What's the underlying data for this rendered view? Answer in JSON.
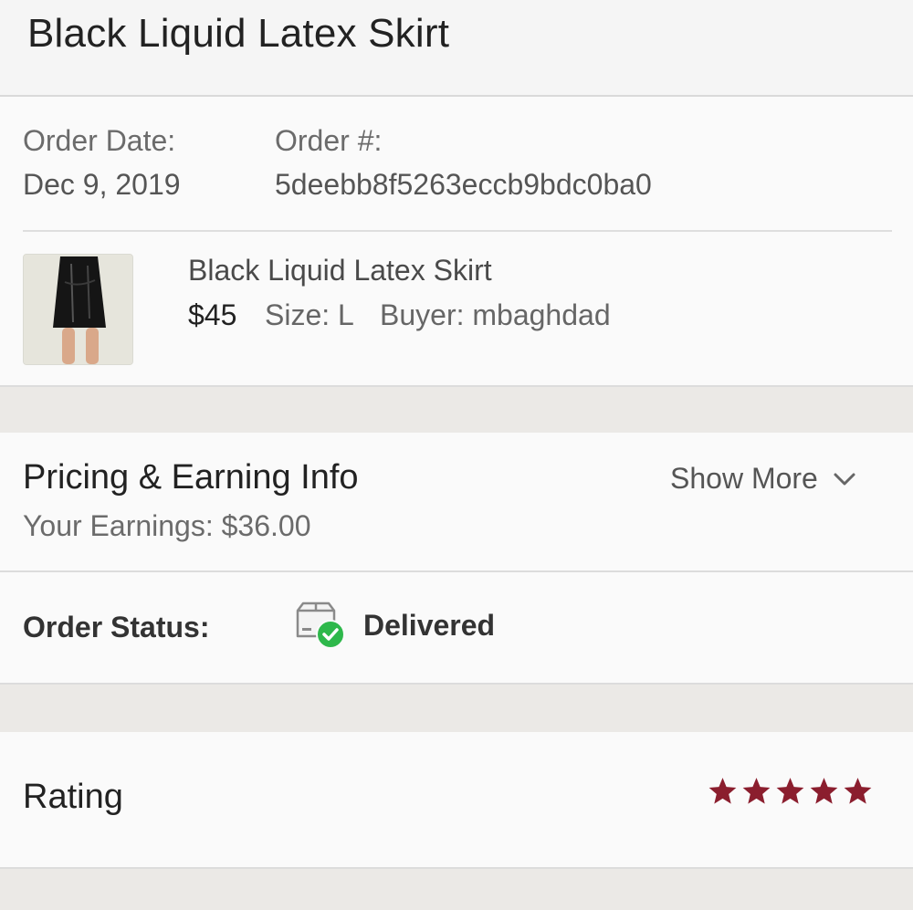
{
  "header": {
    "title": "Black Liquid Latex Skirt"
  },
  "order": {
    "date_label": "Order Date:",
    "date_value": "Dec 9, 2019",
    "number_label": "Order #:",
    "number_value": "5deebb8f5263eccb9bdc0ba0"
  },
  "item": {
    "name": "Black Liquid Latex Skirt",
    "price": "$45",
    "size": "Size: L",
    "buyer": "Buyer: mbaghdad"
  },
  "pricing": {
    "title": "Pricing & Earning Info",
    "earnings": "Your Earnings: $36.00",
    "show_more": "Show More"
  },
  "status": {
    "label": "Order Status:",
    "value": "Delivered"
  },
  "rating": {
    "label": "Rating",
    "stars": 5,
    "max": 5,
    "star_color": "#8b1e2e"
  },
  "colors": {
    "check_green": "#2eb84b",
    "section_gap": "#ebe9e6"
  },
  "icons": {
    "status": "box-check-icon",
    "expand": "chevron-down-icon",
    "star": "star-icon"
  }
}
